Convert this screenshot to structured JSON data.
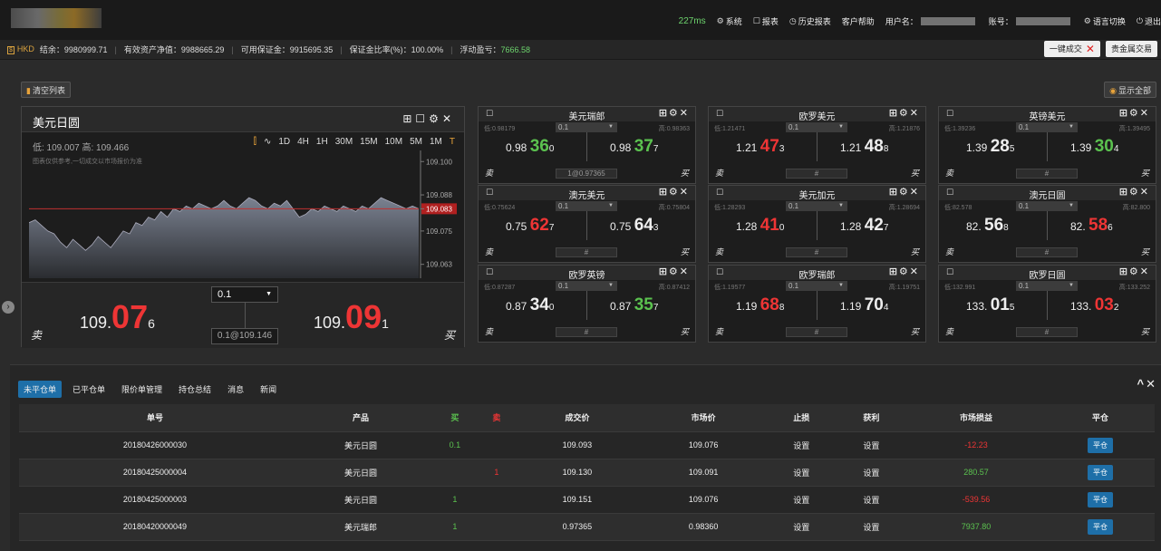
{
  "topbar": {
    "latency": "227ms",
    "system": "系统",
    "report": "报表",
    "history_report": "历史报表",
    "help": "客户帮助",
    "username_label": "用户名：",
    "account_label": "账号：",
    "language": "语言切换",
    "logout": "退出"
  },
  "account": {
    "currency": "HKD",
    "balance": "结余：9980999.71",
    "net_value": "有效资产净值：9988665.29",
    "margin": "可用保证金：9915695.35",
    "margin_ratio": "保证金比率(%)：100.00%",
    "floating_label": "浮动盈亏：",
    "floating_value": "7666.58",
    "one_click": "一键成交",
    "metals": "贵金属交易"
  },
  "workspace": {
    "clear_list": "清空列表",
    "show_all": "显示全部"
  },
  "big_panel": {
    "title": "美元日圆",
    "low_high": "低: 109.007  高: 109.466",
    "note": "图表仅供参考,一切成交以市场报价为准",
    "periods": [
      "1D",
      "4H",
      "1H",
      "30M",
      "15M",
      "10M",
      "5M",
      "1M",
      "T"
    ],
    "sell_prefix": "109.",
    "sell_big": "07",
    "sell_small": "6",
    "buy_prefix": "109.",
    "buy_big": "09",
    "buy_small": "1",
    "lot": "0.1",
    "lot_info": "0.1@109.146",
    "sell_label": "卖",
    "buy_label": "买",
    "y_ticks": [
      "109.100",
      "109.088",
      "109.083",
      "109.075",
      "109.063"
    ]
  },
  "chart_data": {
    "type": "area",
    "title": "美元日圆",
    "ylim": [
      109.058,
      109.104
    ],
    "current": 109.083,
    "values": [
      109.078,
      109.079,
      109.077,
      109.075,
      109.074,
      109.071,
      109.069,
      109.072,
      109.07,
      109.068,
      109.07,
      109.073,
      109.071,
      109.069,
      109.072,
      109.075,
      109.074,
      109.078,
      109.077,
      109.08,
      109.079,
      109.082,
      109.08,
      109.083,
      109.082,
      109.084,
      109.083,
      109.085,
      109.084,
      109.083,
      109.084,
      109.086,
      109.084,
      109.083,
      109.085,
      109.087,
      109.086,
      109.084,
      109.083,
      109.085,
      109.084,
      109.086,
      109.083,
      109.08,
      109.081,
      109.083,
      109.082,
      109.084,
      109.083,
      109.082,
      109.084,
      109.083,
      109.082,
      109.084,
      109.083,
      109.085,
      109.087,
      109.086,
      109.085,
      109.084,
      109.083,
      109.084,
      109.083
    ]
  },
  "tiles": [
    {
      "name": "美元瑞郎",
      "lo": "低:0.98179",
      "hi": "高:0.98363",
      "lot": "0.1",
      "sp": "0.98 ",
      "sb": "36",
      "ss": "0",
      "bp": "0.98 ",
      "bb": "37",
      "bs": "7",
      "bottom": "1@0.97365",
      "sell_color": "green",
      "buy_color": "green"
    },
    {
      "name": "欧罗美元",
      "lo": "低:1.21471",
      "hi": "高:1.21876",
      "lot": "0.1",
      "sp": "1.21 ",
      "sb": "47",
      "ss": "3",
      "bp": "1.21 ",
      "bb": "48",
      "bs": "8",
      "bottom": "#",
      "sell_color": "red",
      "buy_color": "white"
    },
    {
      "name": "英镑美元",
      "lo": "低:1.39236",
      "hi": "高:1.39495",
      "lot": "0.1",
      "sp": "1.39 ",
      "sb": "28",
      "ss": "5",
      "bp": "1.39 ",
      "bb": "30",
      "bs": "4",
      "bottom": "#",
      "sell_color": "white",
      "buy_color": "green"
    },
    {
      "name": "澳元美元",
      "lo": "低:0.75624",
      "hi": "高:0.75804",
      "lot": "0.1",
      "sp": "0.75 ",
      "sb": "62",
      "ss": "7",
      "bp": "0.75 ",
      "bb": "64",
      "bs": "3",
      "bottom": "#",
      "sell_color": "red",
      "buy_color": "white"
    },
    {
      "name": "美元加元",
      "lo": "低:1.28293",
      "hi": "高:1.28694",
      "lot": "0.1",
      "sp": "1.28 ",
      "sb": "41",
      "ss": "0",
      "bp": "1.28 ",
      "bb": "42",
      "bs": "7",
      "bottom": "#",
      "sell_color": "red",
      "buy_color": "white"
    },
    {
      "name": "澳元日圆",
      "lo": "低:82.578",
      "hi": "高:82.800",
      "lot": "0.1",
      "sp": "82. ",
      "sb": "56",
      "ss": "8",
      "bp": "82. ",
      "bb": "58",
      "bs": "6",
      "bottom": "#",
      "sell_color": "white",
      "buy_color": "red"
    },
    {
      "name": "欧罗英镑",
      "lo": "低:0.87287",
      "hi": "高:0.87412",
      "lot": "0.1",
      "sp": "0.87 ",
      "sb": "34",
      "ss": "0",
      "bp": "0.87 ",
      "bb": "35",
      "bs": "7",
      "bottom": "#",
      "sell_color": "white",
      "buy_color": "green"
    },
    {
      "name": "欧罗瑞郎",
      "lo": "低:1.19577",
      "hi": "高:1.19751",
      "lot": "0.1",
      "sp": "1.19 ",
      "sb": "68",
      "ss": "8",
      "bp": "1.19 ",
      "bb": "70",
      "bs": "4",
      "bottom": "#",
      "sell_color": "red",
      "buy_color": "white"
    },
    {
      "name": "欧罗日圆",
      "lo": "低:132.991",
      "hi": "高:133.252",
      "lot": "0.1",
      "sp": "133. ",
      "sb": "01",
      "ss": "5",
      "bp": "133. ",
      "bb": "03",
      "bs": "2",
      "bottom": "#",
      "sell_color": "white",
      "buy_color": "red"
    }
  ],
  "tile_labels": {
    "sell": "卖",
    "buy": "买"
  },
  "bottom": {
    "tabs": [
      "未平仓单",
      "已平仓单",
      "限价单管理",
      "持仓总结",
      "消息",
      "新闻"
    ],
    "columns": [
      "单号",
      "产品",
      "买",
      "卖",
      "成交价",
      "市场价",
      "止损",
      "获利",
      "市场损益",
      "平仓"
    ],
    "rows": [
      {
        "id": "20180426000030",
        "product": "美元日圆",
        "buy": "0.1",
        "sell": "",
        "price": "109.093",
        "market": "109.076",
        "sl": "设置",
        "tp": "设置",
        "pnl": "-12.23",
        "pnl_color": "red",
        "close": "平仓"
      },
      {
        "id": "20180425000004",
        "product": "美元日圆",
        "buy": "",
        "sell": "1",
        "price": "109.130",
        "market": "109.091",
        "sl": "设置",
        "tp": "设置",
        "pnl": "280.57",
        "pnl_color": "green",
        "close": "平仓"
      },
      {
        "id": "20180425000003",
        "product": "美元日圆",
        "buy": "1",
        "sell": "",
        "price": "109.151",
        "market": "109.076",
        "sl": "设置",
        "tp": "设置",
        "pnl": "-539.56",
        "pnl_color": "red",
        "close": "平仓"
      },
      {
        "id": "20180420000049",
        "product": "美元瑞郎",
        "buy": "1",
        "sell": "",
        "price": "0.97365",
        "market": "0.98360",
        "sl": "设置",
        "tp": "设置",
        "pnl": "7937.80",
        "pnl_color": "green",
        "close": "平仓"
      }
    ]
  }
}
